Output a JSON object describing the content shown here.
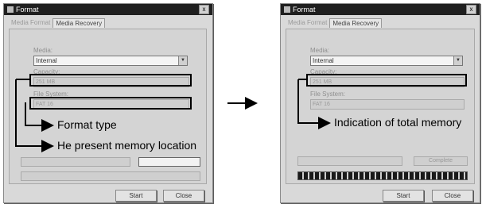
{
  "left_window": {
    "title": "Format",
    "close_glyph": "x",
    "tabs": [
      "Media Format",
      "Media Recovery"
    ],
    "media_label": "Media:",
    "media_value": "Internal",
    "capacity_label": "Capacity:",
    "capacity_value": "251 MB",
    "fs_label": "File System:",
    "fs_value": "FAT 16",
    "start_label": "Start",
    "close_label": "Close"
  },
  "right_window": {
    "title": "Format",
    "close_glyph": "x",
    "tabs": [
      "Media Format",
      "Media Recovery"
    ],
    "media_label": "Media:",
    "media_value": "Internal",
    "capacity_label": "Capacity:",
    "capacity_value": "251 MB",
    "fs_label": "File System:",
    "fs_value": "FAT 16",
    "status_text": "Complete",
    "progress_fraction": 1.0,
    "start_label": "Start",
    "close_label": "Close"
  },
  "callouts": {
    "format_type": "Format type",
    "memory_location": "He present memory location",
    "total_memory": "Indication of total memory"
  },
  "icons": {
    "transition_arrow": "right-arrow-icon"
  }
}
